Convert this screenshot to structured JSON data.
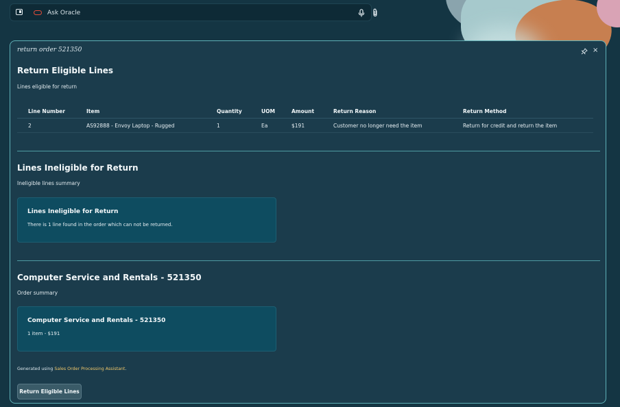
{
  "ask_bar": {
    "placeholder": "Ask Oracle",
    "icons": [
      "sidebar-toggle-icon",
      "oracle-logo-icon",
      "microphone-icon",
      "paperclip-icon"
    ]
  },
  "panel": {
    "title": "return order 521350",
    "icons": [
      "pin-icon",
      "close-icon"
    ],
    "close_glyph": "×"
  },
  "eligible": {
    "title": "Return Eligible Lines",
    "subtitle": "Lines eligible for return",
    "columns": [
      "Line Number",
      "Item",
      "Quantity",
      "UOM",
      "Amount",
      "Return Reason",
      "Return Method"
    ],
    "rows": [
      [
        "2",
        "AS92888 - Envoy Laptop - Rugged",
        "1",
        "Ea",
        "$191",
        "Customer no longer need the item",
        "Return for credit and return the item"
      ]
    ]
  },
  "ineligible": {
    "title": "Lines Ineligible for Return",
    "subtitle": "Ineligible lines summary",
    "card_title": "Lines Ineligible for Return",
    "card_body": "There is 1 line found in the order which can not be returned."
  },
  "order": {
    "title": "Computer Service and Rentals - 521350",
    "subtitle": "Order summary",
    "card_title": "Computer Service and Rentals - 521350",
    "card_body": "1 item - $191"
  },
  "footer": {
    "generated_prefix": "Generated using ",
    "assistant_link": "Sales Order Processing Assistant",
    "generated_suffix": ".",
    "button_label": "Return Eligible Lines"
  },
  "colors": {
    "background": "#143543",
    "panel": "#1b3c4c",
    "panel_border": "#5fb1b7",
    "card": "#0e4c60",
    "link": "#f0c76a",
    "oracle_red": "#e44d39"
  }
}
